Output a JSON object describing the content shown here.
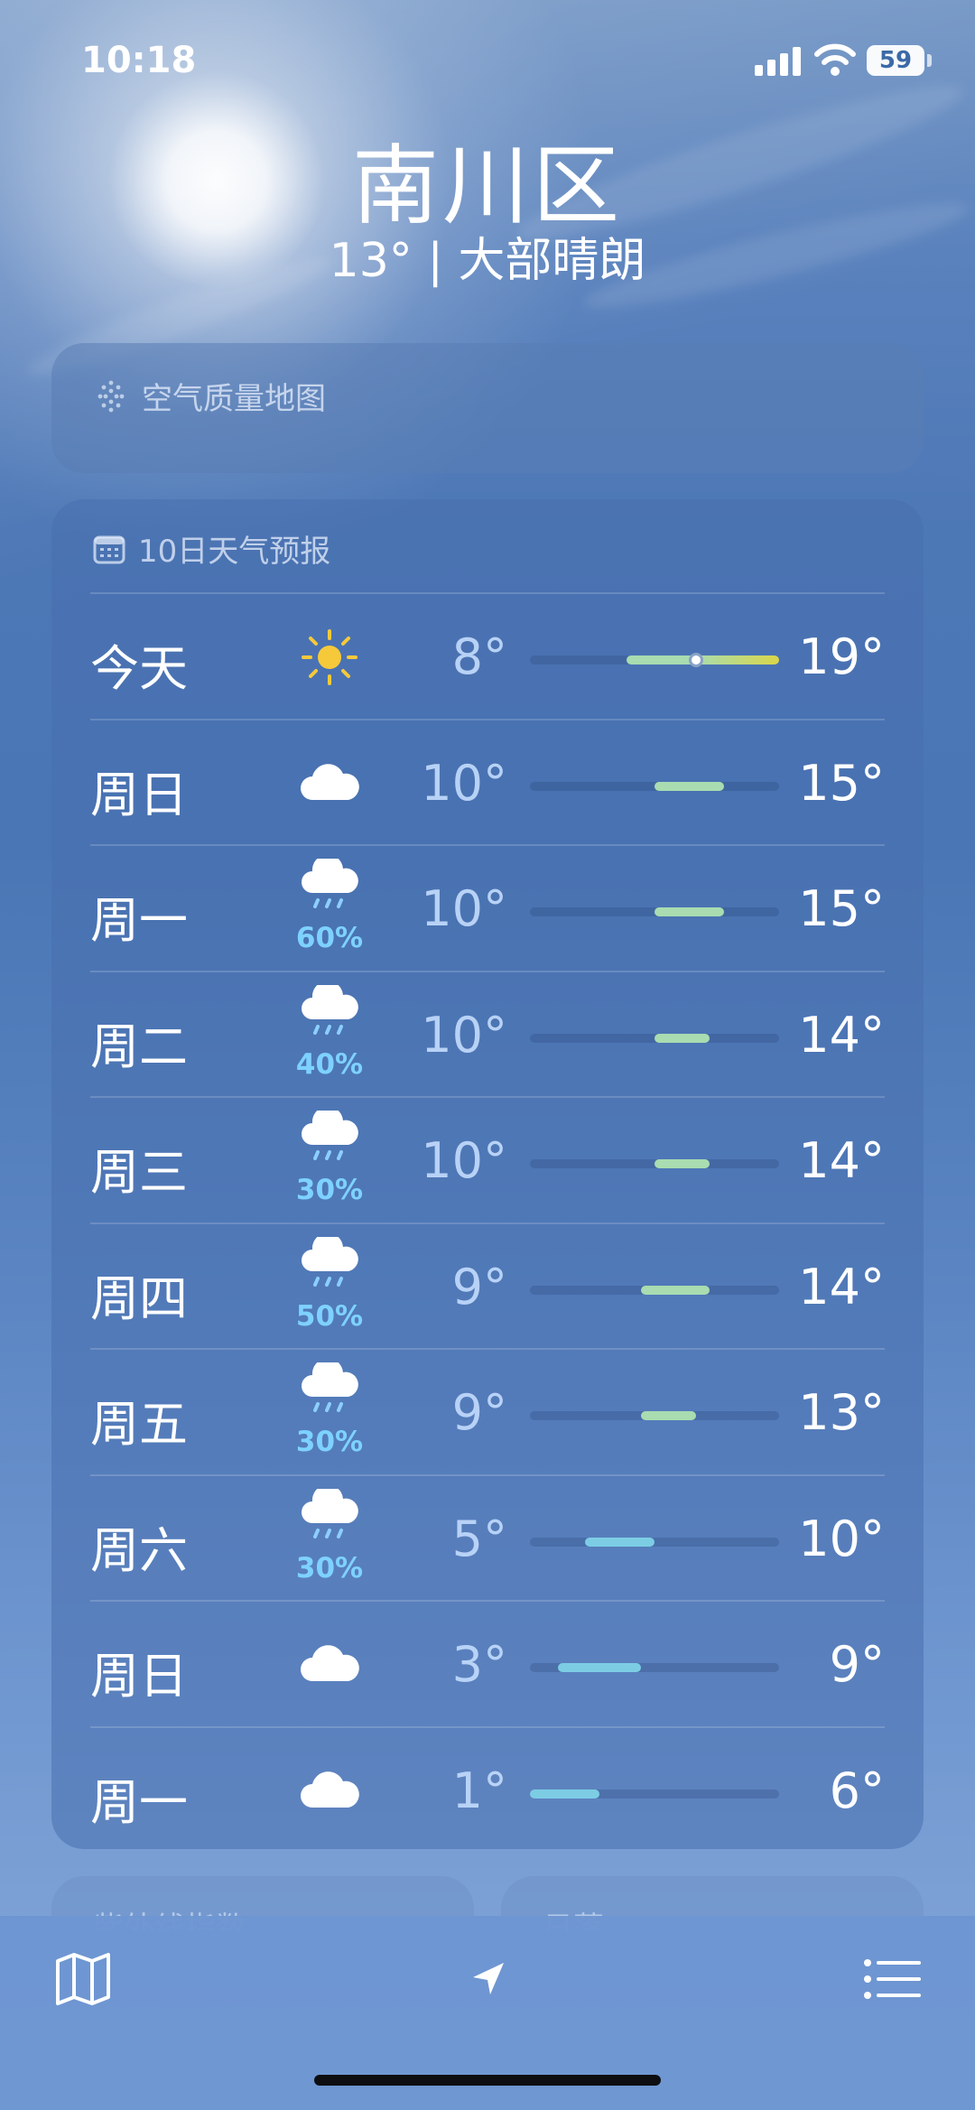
{
  "status_bar": {
    "time": "10:18",
    "battery": "59",
    "battery_level": 0.59
  },
  "header": {
    "city": "南川区",
    "summary": "13° | 大部晴朗"
  },
  "air_quality_card": {
    "title": "空气质量地图",
    "icon": "air-quality-dots-icon"
  },
  "forecast_card": {
    "title": "10日天气预报",
    "icon": "calendar-icon",
    "range": {
      "min": 1,
      "max": 19
    },
    "current_temp": 13,
    "rows": [
      {
        "day": "今天",
        "icon": "sun-icon",
        "pop": "",
        "low": "8°",
        "high": "19°",
        "low_value": 8,
        "high_value": 19,
        "today": true
      },
      {
        "day": "周日",
        "icon": "cloud-icon",
        "pop": "",
        "low": "10°",
        "high": "15°",
        "low_value": 10,
        "high_value": 15
      },
      {
        "day": "周一",
        "icon": "cloud-rain-icon",
        "pop": "60%",
        "low": "10°",
        "high": "15°",
        "low_value": 10,
        "high_value": 15
      },
      {
        "day": "周二",
        "icon": "cloud-rain-icon",
        "pop": "40%",
        "low": "10°",
        "high": "14°",
        "low_value": 10,
        "high_value": 14
      },
      {
        "day": "周三",
        "icon": "cloud-rain-icon",
        "pop": "30%",
        "low": "10°",
        "high": "14°",
        "low_value": 10,
        "high_value": 14
      },
      {
        "day": "周四",
        "icon": "cloud-rain-icon",
        "pop": "50%",
        "low": "9°",
        "high": "14°",
        "low_value": 9,
        "high_value": 14
      },
      {
        "day": "周五",
        "icon": "cloud-rain-icon",
        "pop": "30%",
        "low": "9°",
        "high": "13°",
        "low_value": 9,
        "high_value": 13
      },
      {
        "day": "周六",
        "icon": "cloud-rain-icon",
        "pop": "30%",
        "low": "5°",
        "high": "10°",
        "low_value": 5,
        "high_value": 10
      },
      {
        "day": "周日",
        "icon": "cloud-icon",
        "pop": "",
        "low": "3°",
        "high": "9°",
        "low_value": 3,
        "high_value": 9
      },
      {
        "day": "周一",
        "icon": "cloud-icon",
        "pop": "",
        "low": "1°",
        "high": "6°",
        "low_value": 1,
        "high_value": 6
      }
    ]
  },
  "peek_cards": [
    {
      "title": "紫外线指数",
      "icon": "sun-small-icon"
    },
    {
      "title": "日落",
      "icon": "sunset-icon"
    }
  ],
  "bottom_bar": {
    "left_icon": "map-icon",
    "center_icon": "location-arrow-icon",
    "right_icon": "list-icon"
  },
  "colors": {
    "pop_text": "#7ed2ff",
    "cool_bar": "#7ccde4",
    "mild_bar": "#a9dcb0",
    "warm_bar": "#d9d64a",
    "sun": "#f6c93a"
  }
}
